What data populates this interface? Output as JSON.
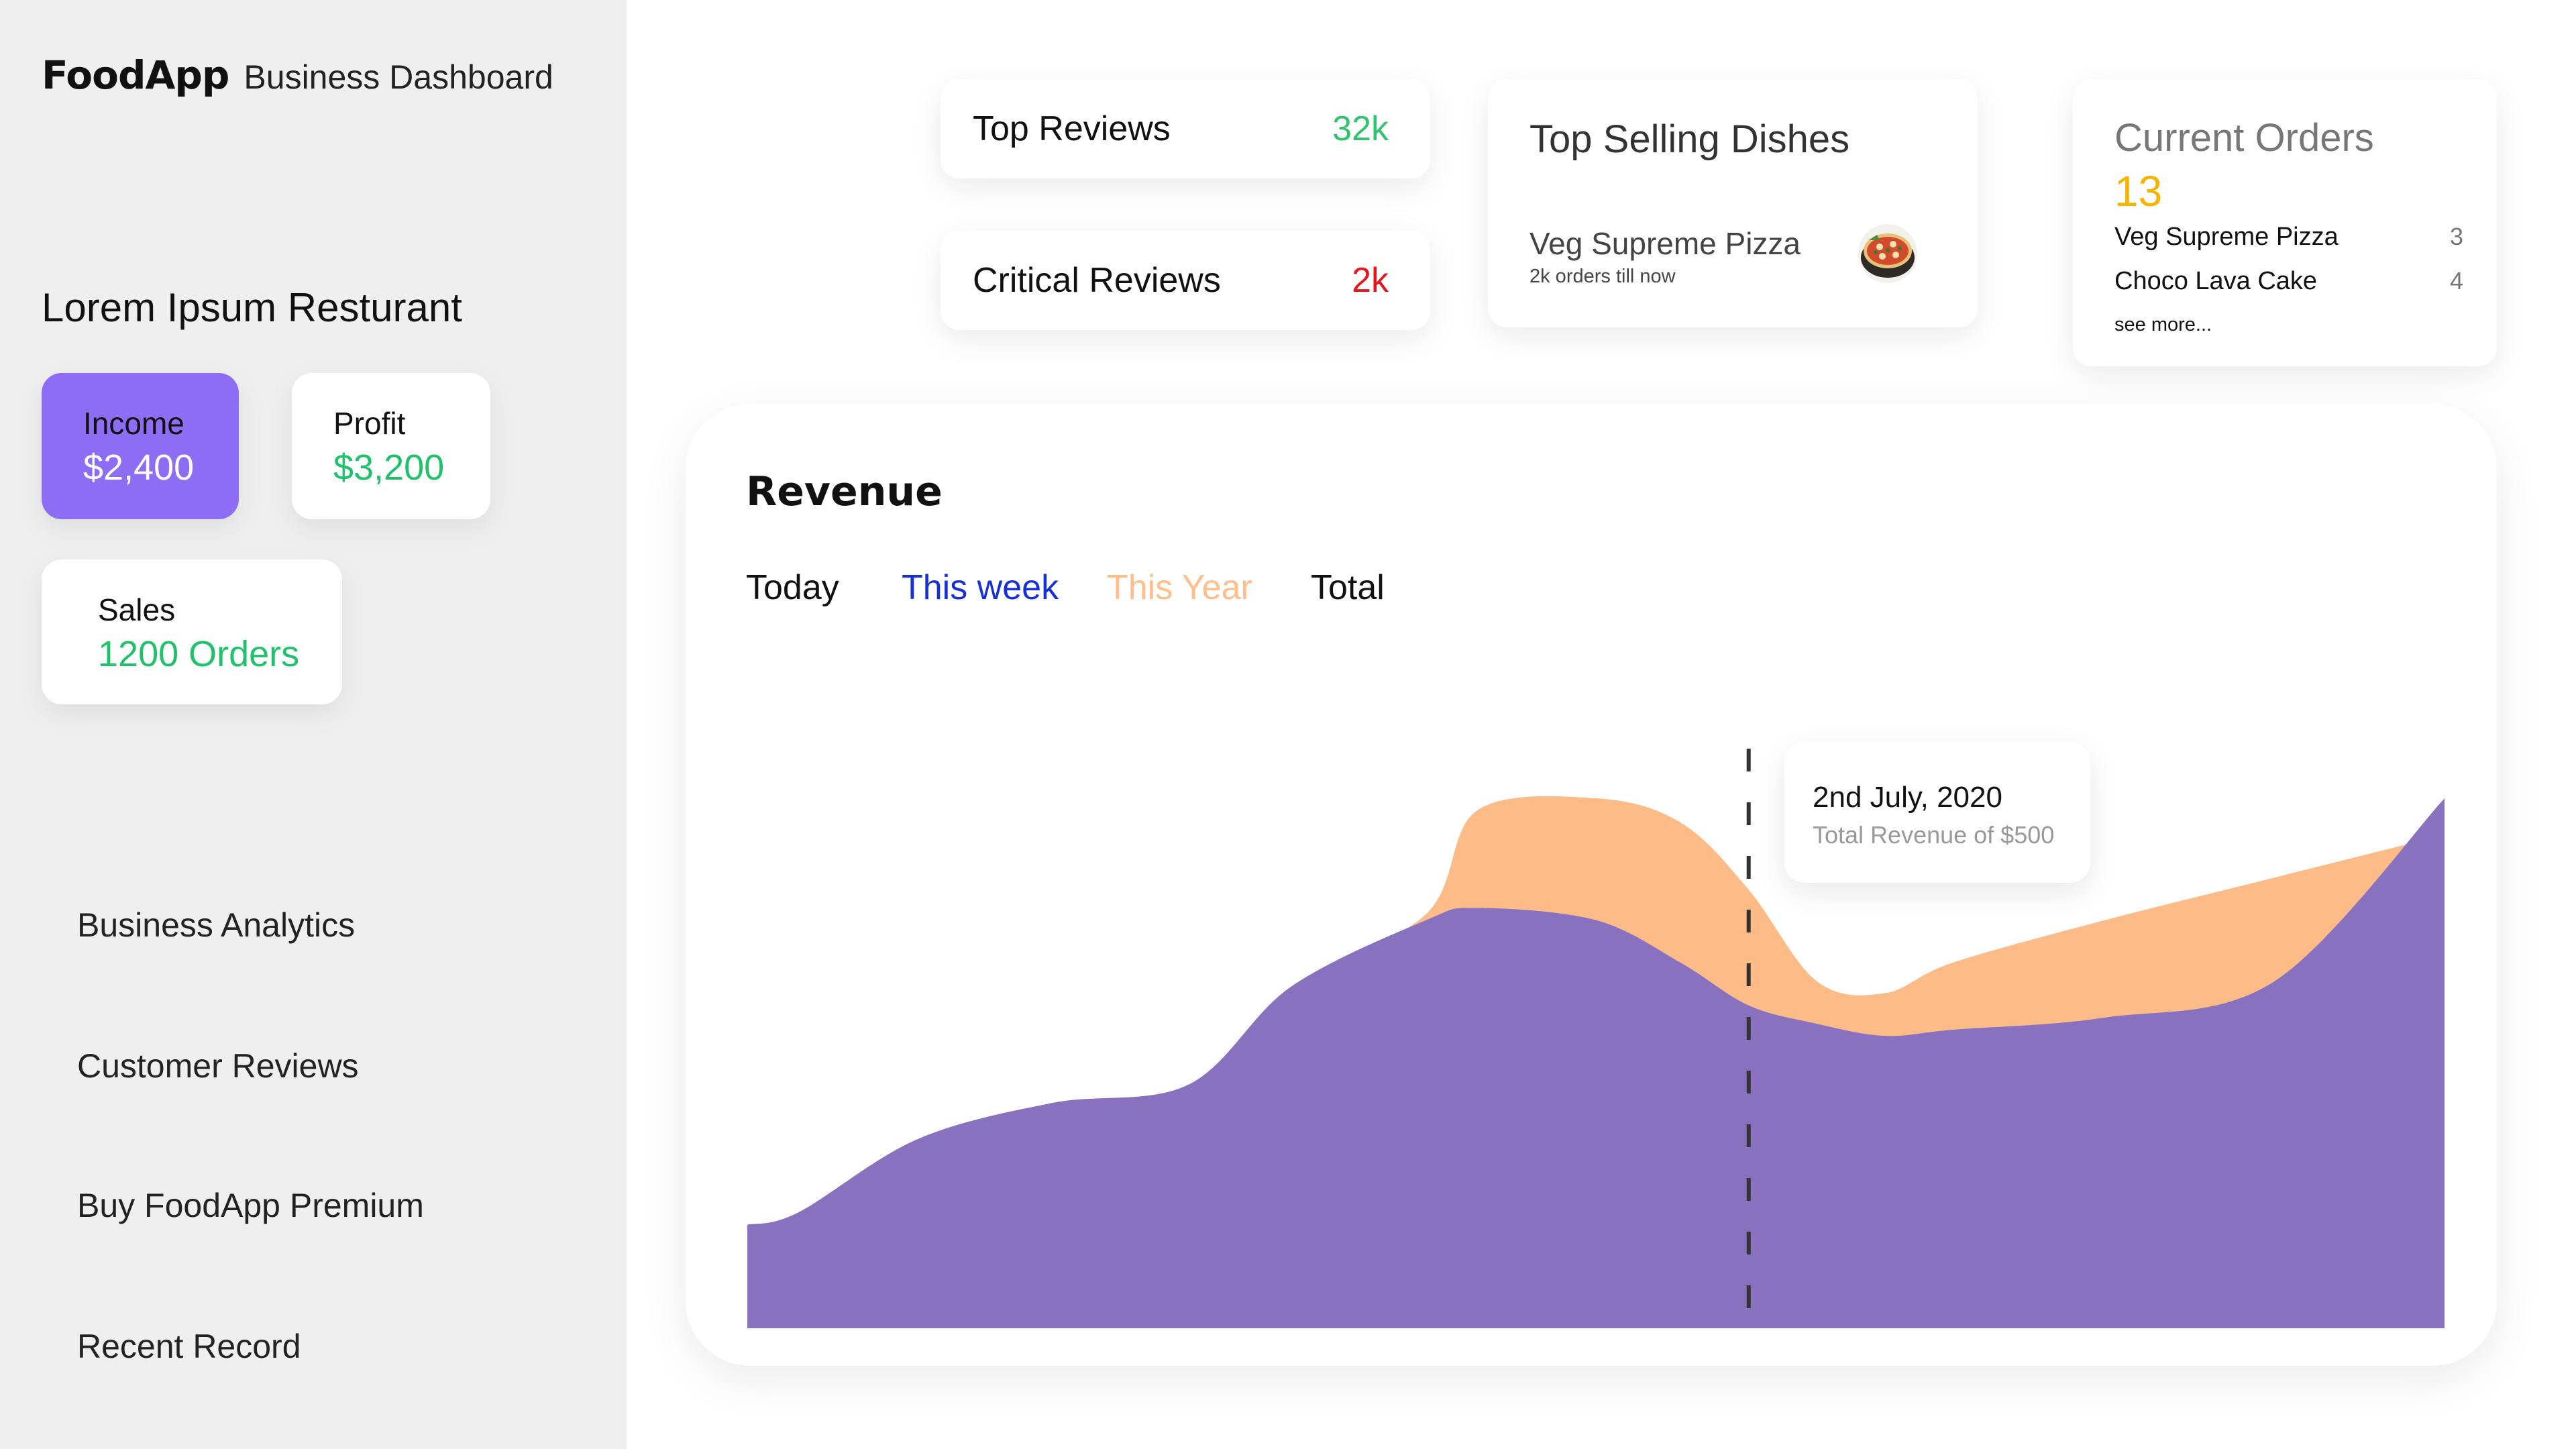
{
  "brand": {
    "name": "FoodApp",
    "subtitle": "Business Dashboard"
  },
  "restaurant": {
    "name": "Lorem Ipsum Resturant"
  },
  "stats": {
    "income": {
      "label": "Income",
      "value": "$2,400"
    },
    "profit": {
      "label": "Profit",
      "value": "$3,200"
    },
    "sales": {
      "label": "Sales",
      "value": "1200 Orders"
    }
  },
  "nav": {
    "items": [
      {
        "label": "Business Analytics"
      },
      {
        "label": "Customer Reviews"
      },
      {
        "label": "Buy FoodApp Premium"
      },
      {
        "label": "Recent Record"
      }
    ]
  },
  "reviews": {
    "top": {
      "label": "Top Reviews",
      "value": "32k",
      "color": "#2fc46d"
    },
    "critical": {
      "label": "Critical Reviews",
      "value": "2k",
      "color": "#e6161b"
    }
  },
  "top_selling": {
    "title": "Top Selling Dishes",
    "dish": {
      "name": "Veg Supreme Pizza",
      "subtitle": "2k orders till now",
      "icon": "pizza-image"
    }
  },
  "current_orders": {
    "title": "Current Orders",
    "count": "13",
    "items": [
      {
        "name": "Veg Supreme Pizza",
        "qty": "3"
      },
      {
        "name": "Choco Lava Cake",
        "qty": "4"
      }
    ],
    "see_more": "see more..."
  },
  "revenue": {
    "title": "Revenue",
    "tabs": [
      {
        "label": "Today",
        "color": "#111111"
      },
      {
        "label": "This week",
        "color": "#1530d8"
      },
      {
        "label": "This Year",
        "color": "#ffbf8a"
      },
      {
        "label": "Total",
        "color": "#111111"
      }
    ],
    "tooltip": {
      "date": "2nd July, 2020",
      "text": "Total Revenue of $500"
    }
  },
  "colors": {
    "accent_purple": "#8e6df5",
    "area_purple": "#8872c0",
    "area_orange": "#fdbb87",
    "green": "#1fc16b",
    "orange_count": "#f6b400"
  },
  "chart_data": {
    "type": "area",
    "title": "Revenue",
    "xlabel": "",
    "ylabel": "",
    "x": [
      0,
      0.03,
      0.1,
      0.18,
      0.26,
      0.32,
      0.4,
      0.43,
      0.5,
      0.55,
      0.59,
      0.63,
      0.67,
      0.71,
      0.8,
      0.9,
      1.0
    ],
    "series": [
      {
        "color": "#fdbb87",
        "values": [
          0.17,
          0.19,
          0.31,
          0.37,
          0.4,
          0.56,
          0.68,
          0.85,
          0.87,
          0.83,
          0.72,
          0.57,
          0.55,
          0.6,
          0.67,
          0.74,
          0.81
        ]
      },
      {
        "color": "#8872c0",
        "values": [
          0.17,
          0.19,
          0.31,
          0.37,
          0.4,
          0.56,
          0.67,
          0.69,
          0.67,
          0.6,
          0.53,
          0.5,
          0.48,
          0.49,
          0.51,
          0.57,
          0.87
        ]
      }
    ],
    "marker_x": 0.59,
    "grid": false,
    "legend": "none"
  }
}
